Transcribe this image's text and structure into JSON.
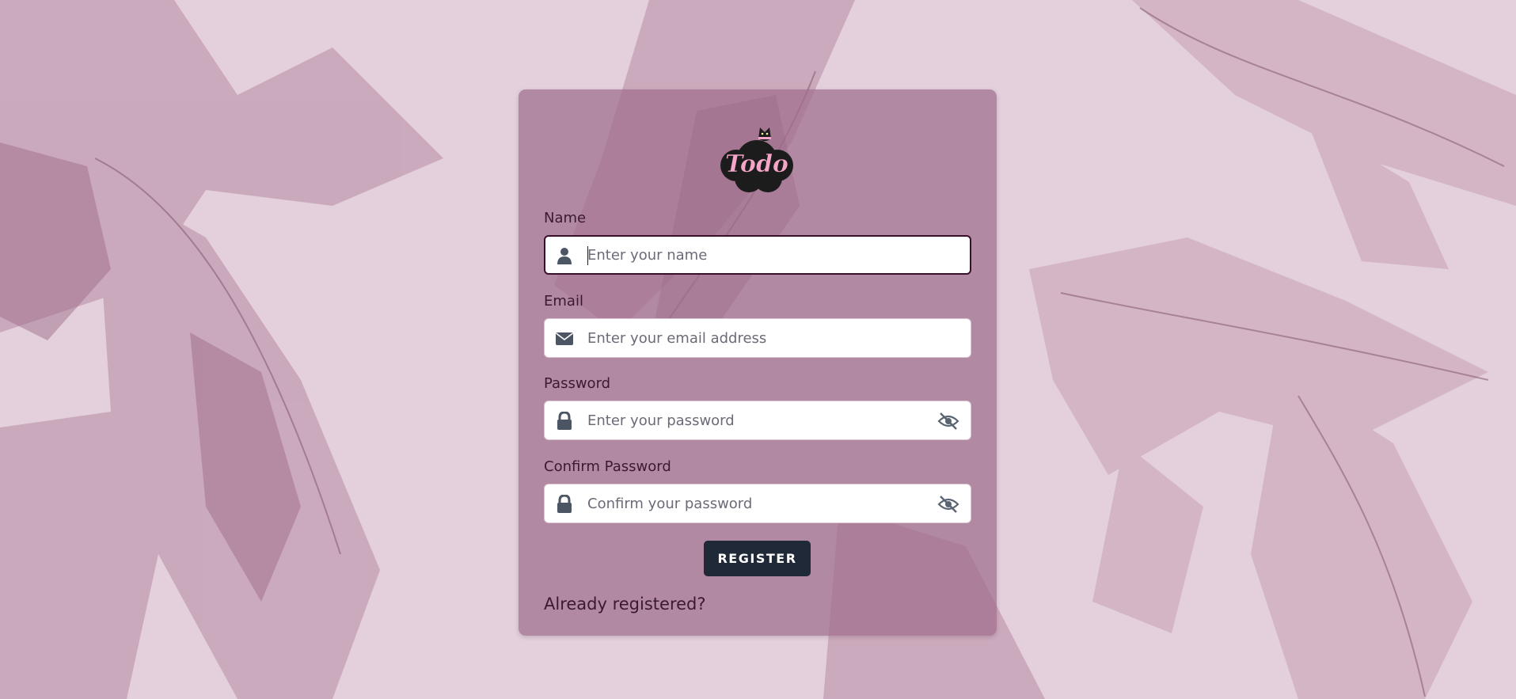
{
  "colors": {
    "background": "#e2cfdb",
    "card": "#a06e8c",
    "button": "#1f2937",
    "label": "#3b1a2e",
    "logo_text": "#f4a6c8"
  },
  "logo": {
    "text": "Todo",
    "icon": "cat-cloud-logo"
  },
  "form": {
    "name": {
      "label": "Name",
      "placeholder": "Enter your name",
      "icon": "user-icon"
    },
    "email": {
      "label": "Email",
      "placeholder": "Enter your email address",
      "icon": "envelope-icon"
    },
    "password": {
      "label": "Password",
      "placeholder": "Enter your password",
      "icon": "lock-icon",
      "toggle_icon": "eye-slash-icon"
    },
    "confirm_password": {
      "label": "Confirm Password",
      "placeholder": "Confirm your password",
      "icon": "lock-icon",
      "toggle_icon": "eye-slash-icon"
    },
    "register_label": "REGISTER",
    "already_registered_label": "Already registered?"
  }
}
